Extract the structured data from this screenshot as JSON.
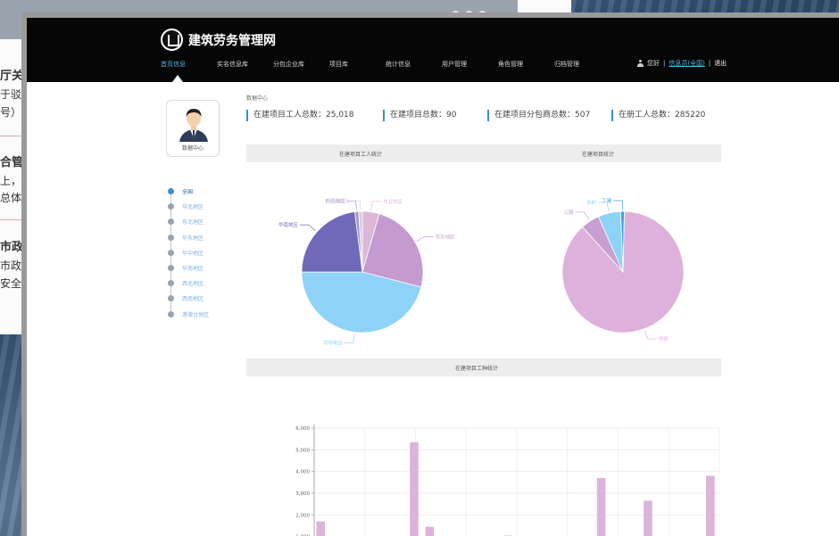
{
  "background": {
    "carousel_dots": 3,
    "article_fragments": [
      {
        "text": "厅关于",
        "top": 76,
        "heading": true
      },
      {
        "text": "于驳",
        "top": 96,
        "heading": false
      },
      {
        "text": "号）的",
        "top": 116,
        "heading": false
      },
      {
        "text": "合管",
        "top": 173,
        "heading": true
      },
      {
        "text": "上，",
        "top": 193,
        "heading": false
      },
      {
        "text": "总体",
        "top": 212,
        "heading": false
      },
      {
        "text": "市政",
        "top": 268,
        "heading": true
      },
      {
        "text": "市政",
        "top": 288,
        "heading": false
      },
      {
        "text": "安全",
        "top": 308,
        "heading": false
      }
    ]
  },
  "app": {
    "title": "建筑劳务管理网",
    "nav": [
      {
        "label": "首页信息",
        "active": true
      },
      {
        "label": "实名信息库",
        "active": false
      },
      {
        "label": "分包企业库",
        "active": false
      },
      {
        "label": "项目库",
        "active": false
      },
      {
        "label": "统计信息",
        "active": false
      },
      {
        "label": "用户管理",
        "active": false
      },
      {
        "label": "角色管理",
        "active": false
      },
      {
        "label": "归档管理",
        "active": false
      }
    ],
    "greeting": "您好",
    "user_name": "信息员(全国)",
    "logout_label": "退出"
  },
  "sidebar": {
    "avatar_label": "数据中心",
    "regions": [
      {
        "label": "全国",
        "active": true
      },
      {
        "label": "华北地区",
        "active": false
      },
      {
        "label": "东北地区",
        "active": false
      },
      {
        "label": "华东地区",
        "active": false
      },
      {
        "label": "华中地区",
        "active": false
      },
      {
        "label": "华南地区",
        "active": false
      },
      {
        "label": "西北地区",
        "active": false
      },
      {
        "label": "西南地区",
        "active": false
      },
      {
        "label": "港澳台地区",
        "active": false
      }
    ]
  },
  "breadcrumb": "数据中心",
  "stats": [
    {
      "label": "在建项目工人总数：25,018"
    },
    {
      "label": "在建项目总数：90"
    },
    {
      "label": "在建项目分包商总数：507"
    },
    {
      "label": "在册工人总数：285220"
    }
  ],
  "sections": {
    "workers_pie_title": "在建项目工人统计",
    "projects_pie_title": "在建项目统计",
    "bar_title": "在建项目工种统计"
  },
  "chart_data": [
    {
      "type": "pie",
      "title": "在建项目工人统计",
      "slices": [
        {
          "name": "东北地区",
          "value": 4.5,
          "color": "#ddb7d8"
        },
        {
          "name": "华东地区",
          "value": 24.5,
          "color": "#c59ad0"
        },
        {
          "name": "华中地区",
          "value": 46,
          "color": "#8ed2f7"
        },
        {
          "name": "华南地区",
          "value": 23,
          "color": "#7068b8"
        },
        {
          "name": "西北地区",
          "value": 1,
          "color": "#a397c7"
        },
        {
          "name": "西南地区",
          "value": 1,
          "color": "#d8c9e2"
        }
      ]
    },
    {
      "type": "pie",
      "title": "在建项目统计",
      "slices": [
        {
          "name": "工建",
          "value": 1,
          "color": "#3aa4e6"
        },
        {
          "name": "市政",
          "value": 88,
          "color": "#ddb1dc"
        },
        {
          "name": "公路",
          "value": 5,
          "color": "#c89fd2"
        },
        {
          "name": "水利",
          "value": 6,
          "color": "#8ed2f7"
        }
      ]
    },
    {
      "type": "bar",
      "title": "在建项目工种统计",
      "y_ticks": [
        "1,000",
        "2,000",
        "3,000",
        "4,000",
        "5,000",
        "6,000"
      ],
      "ylim": [
        0,
        6000
      ],
      "values": [
        1700,
        0,
        0,
        0,
        0,
        0,
        5350,
        1450,
        900,
        0,
        0,
        0,
        1050,
        0,
        0,
        0,
        0,
        0,
        3700,
        0,
        0,
        2650,
        0,
        0,
        0,
        3800
      ],
      "color": "#dcb4d9"
    }
  ]
}
